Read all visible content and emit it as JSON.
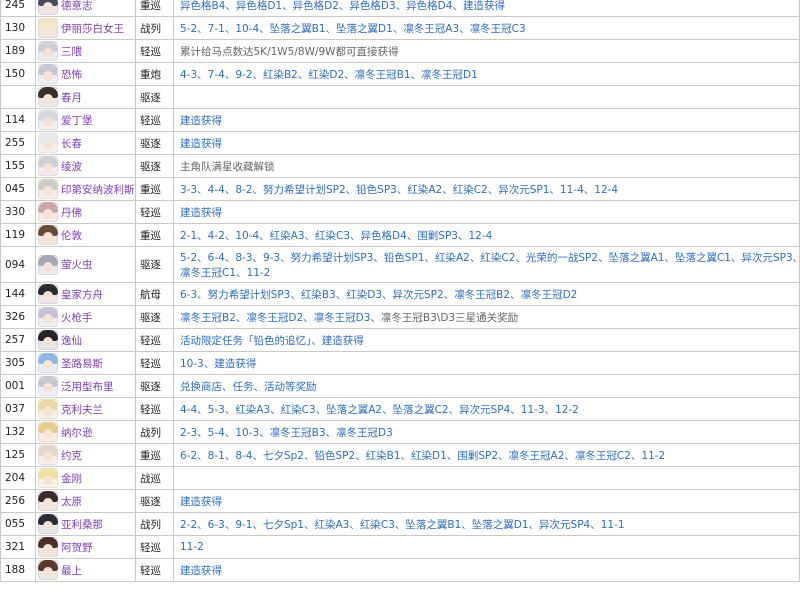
{
  "rows": [
    {
      "num": "245",
      "name": "德意志",
      "type": "重巡",
      "hair": "#4a4a5a",
      "bg": "#e9e4ee",
      "src": "异色格B4、异色格D1、异色格D2、异色格D3、异色格D4、建造获得"
    },
    {
      "num": "130",
      "name": "伊丽莎白女王",
      "type": "战列",
      "hair": "#f0e6c8",
      "bg": "#eeeae0",
      "src": "5-2、7-1、10-4、坠落之翼B1、坠落之翼D1、凛冬王冠A3、凛冬王冠C3"
    },
    {
      "num": "189",
      "name": "三隈",
      "type": "轻巡",
      "hair": "#d0d0d8",
      "bg": "#eceff2",
      "src": "累计给马点数达5K/1W5/8W/9W都可直接获得",
      "plain": true
    },
    {
      "num": "150",
      "name": "恐怖",
      "type": "重炮",
      "hair": "#c8c8d4",
      "bg": "#eeeef3",
      "src": "4-3、7-4、9-2、红染B2、红染D2、凛冬王冠B1、凛冬王冠D1"
    },
    {
      "num": "",
      "name": "春月",
      "type": "驱逐",
      "hair": "#3a2e2a",
      "bg": "#efe8e4",
      "src": ""
    },
    {
      "num": "114",
      "name": "爱丁堡",
      "type": "轻巡",
      "hair": "#d8d8e0",
      "bg": "#eef0f4",
      "src": "建造获得"
    },
    {
      "num": "255",
      "name": "长春",
      "type": "驱逐",
      "hair": "#e8e8ee",
      "bg": "#f1f1f4",
      "src": "建造获得"
    },
    {
      "num": "155",
      "name": "绫波",
      "type": "驱逐",
      "hair": "#cfcfd6",
      "bg": "#efeff2",
      "src": "主角队满星收藏解锁",
      "plain": true
    },
    {
      "num": "045",
      "name": "印第安纳波利斯",
      "type": "重巡",
      "hair": "#d2ccc6",
      "bg": "#f2eeea",
      "src": "3-3、4-4、8-2、努力希望计划SP2、铅色SP3、红染A2、红染C2、异次元SP1、11-4、12-4"
    },
    {
      "num": "330",
      "name": "丹佛",
      "type": "轻巡",
      "hair": "#caa8a8",
      "bg": "#f4eaea",
      "src": "建造获得"
    },
    {
      "num": "119",
      "name": "伦敦",
      "type": "重巡",
      "hair": "#6a4a36",
      "bg": "#efe6df",
      "src": "2-1、4-2、10-4、红染A3、红染C3、异色格D4、围剿SP3、12-4"
    },
    {
      "num": "094",
      "name": "萤火虫",
      "type": "驱逐",
      "hair": "#a8a8b4",
      "bg": "#ededf1",
      "src": "5-2、6-4、8-3、9-3、努力希望计划SP3、铅色SP1、红染A2、红染C2、光荣的一战SP2、坠落之翼A1、坠落之翼C1、异次元SP3、凛冬王冠A1、",
      "src2": "凛冬王冠C1、11-2",
      "tall": true
    },
    {
      "num": "144",
      "name": "皇家方舟",
      "type": "航母",
      "hair": "#2a2a32",
      "bg": "#e8e8ec",
      "src": "6-3、努力希望计划SP3、红染B3、红染D3、异次元SP2、凛冬王冠B2、凛冬王冠D2"
    },
    {
      "num": "326",
      "name": "火枪手",
      "type": "驱逐",
      "hair": "#c6c0d8",
      "bg": "#eeecf4",
      "src": "凛冬王冠B2、凛冬王冠D2、凛冬王冠D3、凛冬王冠B3\\D3三星通关奖励",
      "plain_tail": true
    },
    {
      "num": "257",
      "name": "逸仙",
      "type": "轻巡",
      "hair": "#26242a",
      "bg": "#e6e4e8",
      "src": "活动限定任务「铅色的追忆」、建造获得"
    },
    {
      "num": "305",
      "name": "圣路易斯",
      "type": "轻巡",
      "hair": "#8fb8e4",
      "bg": "#e6eef8",
      "src": "10-3、建造获得"
    },
    {
      "num": "001",
      "name": "泛用型布里",
      "type": "驱逐",
      "hair": "#c8c8d0",
      "bg": "#eff0f3",
      "src": "兑换商店、任务、活动等奖励"
    },
    {
      "num": "037",
      "name": "克利夫兰",
      "type": "轻巡",
      "hair": "#ead8a6",
      "bg": "#f6f1e2",
      "src": "4-4、5-3、红染A3、红染C3、坠落之翼A2、坠落之翼C2、异次元SP4、11-3、12-2"
    },
    {
      "num": "132",
      "name": "纳尔逊",
      "type": "战列",
      "hair": "#e6c98e",
      "bg": "#f6efe0",
      "src": "2-3、5-4、10-3、凛冬王冠B3、凛冬王冠D3"
    },
    {
      "num": "125",
      "name": "约克",
      "type": "重巡",
      "hair": "#e4d8cc",
      "bg": "#f4efe9",
      "src": "6-2、8-1、8-4、七夕Sp2、铅色SP2、红染B1、红染D1、围剿SP2、凛冬王冠A2、凛冬王冠C2、11-2"
    },
    {
      "num": "204",
      "name": "金刚",
      "type": "战巡",
      "hair": "#efe2a4",
      "bg": "#f8f4e2",
      "src": ""
    },
    {
      "num": "256",
      "name": "太原",
      "type": "驱逐",
      "hair": "#3a2c2a",
      "bg": "#ece6e2",
      "src": "建造获得"
    },
    {
      "num": "055",
      "name": "亚利桑那",
      "type": "战列",
      "hair": "#2c2a34",
      "bg": "#e8e7ec",
      "src": "2-2、6-3、9-1、七夕Sp1、红染A3、红染C3、坠落之翼B1、坠落之翼D1、异次元SP4、11-1"
    },
    {
      "num": "321",
      "name": "阿贺野",
      "type": "轻巡",
      "hair": "#4a3026",
      "bg": "#efe6e0",
      "src": "11-2"
    },
    {
      "num": "188",
      "name": "最上",
      "type": "轻巡",
      "hair": "#5a3a2e",
      "bg": "#efe8e2",
      "src": "建造获得"
    }
  ]
}
